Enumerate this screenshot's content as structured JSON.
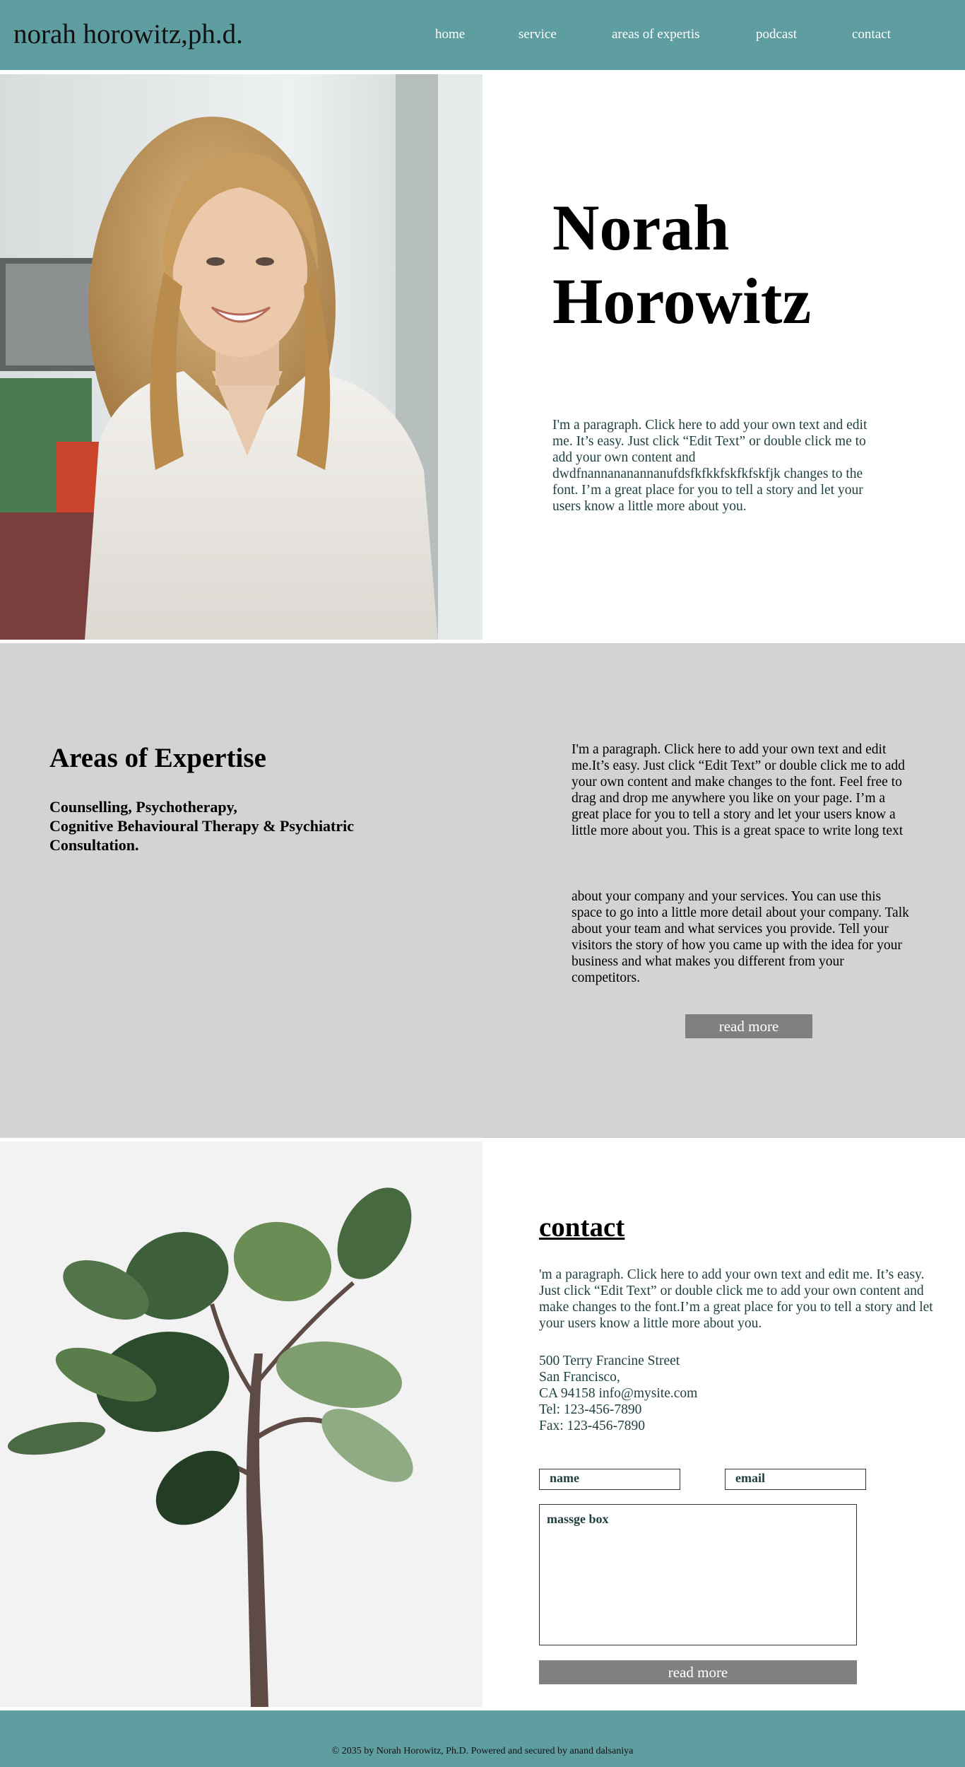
{
  "header": {
    "brand": "norah horowitz,ph.d.",
    "nav": [
      {
        "label": "home"
      },
      {
        "label": "service"
      },
      {
        "label": "areas of expertis"
      },
      {
        "label": "podcast"
      },
      {
        "label": "contact"
      }
    ]
  },
  "hero": {
    "title_line1": "Norah",
    "title_line2": "Horowitz",
    "paragraph": "I'm a paragraph. Click here to add your own text and edit me. It’s easy. Just click “Edit Text” or double click me to add your own content and dwdfnannananannanufdsfkfkkfskfkfskfjk changes to the font. I’m a great place for you to tell a story and let your users know a little more about you."
  },
  "expertise": {
    "title": "Areas of Expertise",
    "subtitle_line1": "Counselling, Psychotherapy,",
    "subtitle_line2": "Cognitive Behavioural Therapy & Psychiatric",
    "subtitle_line3": "Consultation.",
    "paragraph1": "I'm a paragraph. Click here to add your own text and edit me.It’s easy. Just click “Edit Text” or double click me to add your own content and make changes to the font. Feel free to drag and drop me anywhere you like on your page. I’m a great place for you to tell a story and let your users know a little more about you. This is a great space to write long text",
    "paragraph2": "about your company and your services. You can use this space to go into a little more detail about your company. Talk about your team and what services you provide. Tell your visitors the story of how you came up with the idea for your business and what makes you different from your competitors.",
    "button_label": "read more"
  },
  "contact": {
    "title": "contact",
    "paragraph": "'m a paragraph. Click here to add your own text and edit me. It’s easy. Just click “Edit Text” or double click me to add your own content and make changes to the font.I’m a great place for you to tell a story and let your users know a little more about you.",
    "address_line1": "500 Terry Francine Street",
    "address_line2": "San Francisco,",
    "address_line3": "CA 94158 info@mysite.com",
    "tel": "Tel: 123-456-7890",
    "fax": "Fax: 123-456-7890",
    "name_placeholder": "name",
    "email_placeholder": "email",
    "message_placeholder": "massge box",
    "button_label": "read more"
  },
  "footer": {
    "text": "© 2035 by Norah Horowitz, Ph.D. Powered and secured by anand dalsaniya"
  },
  "colors": {
    "header_bg": "#5f9ea0",
    "expertise_bg": "#d4d2d3",
    "button_bg": "#808080"
  }
}
